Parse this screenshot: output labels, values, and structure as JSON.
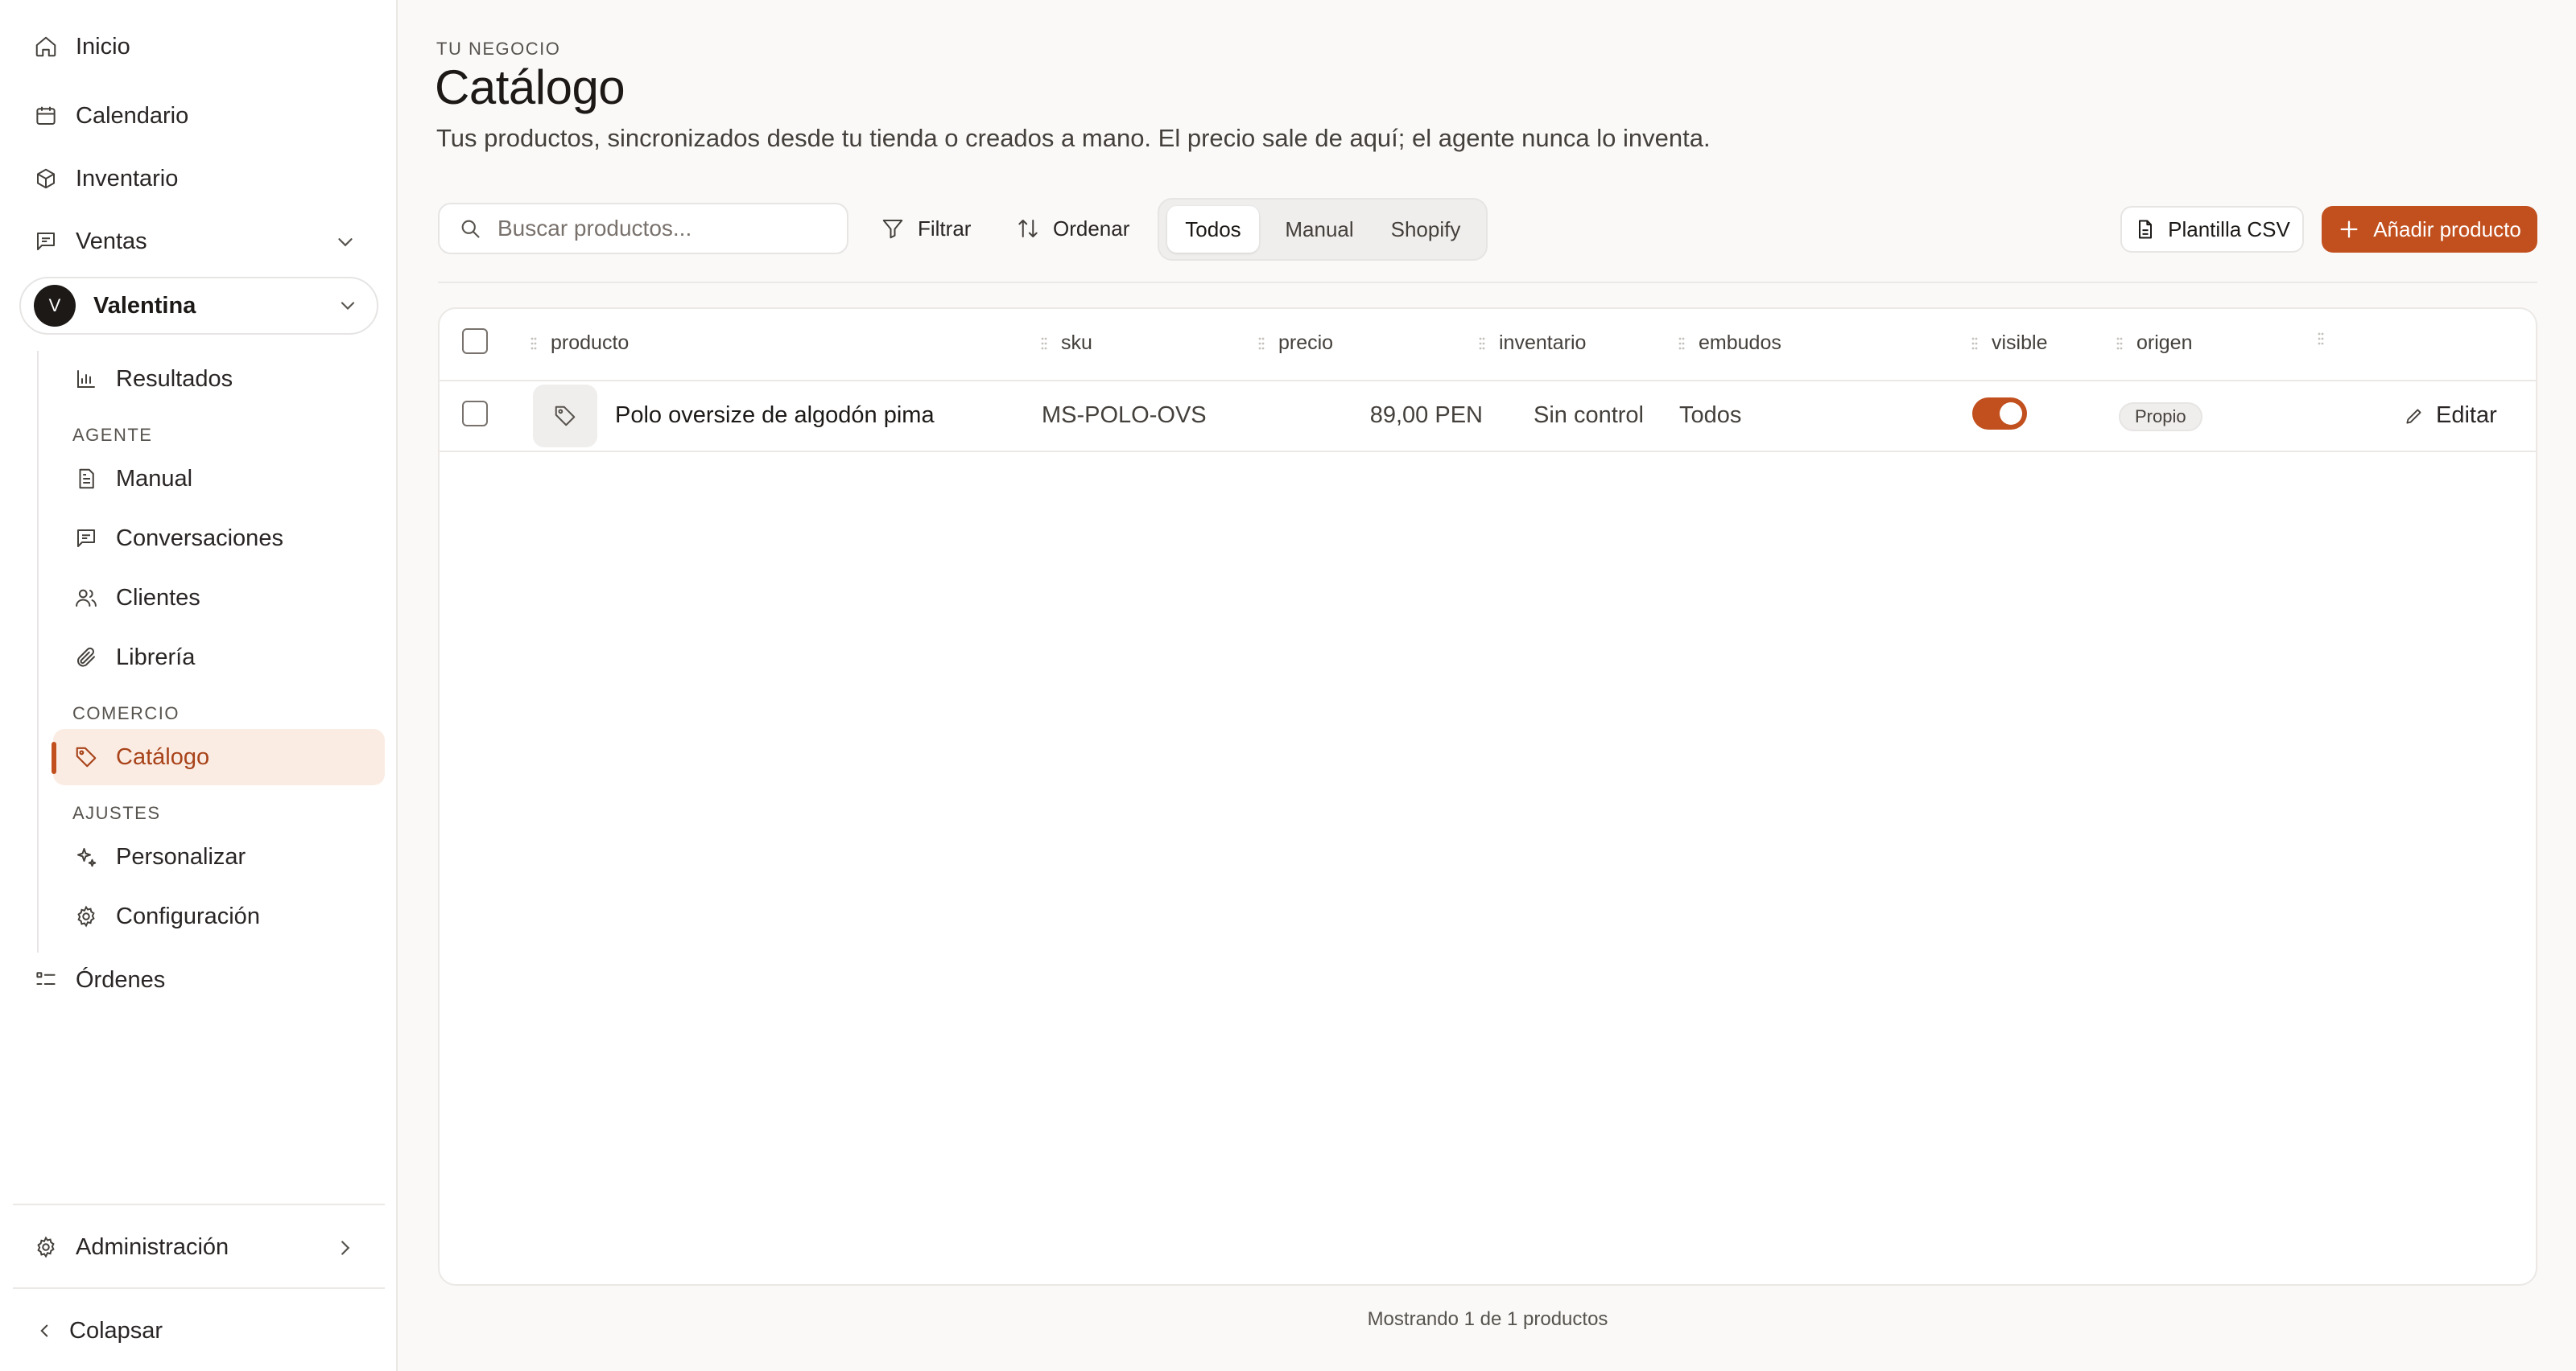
{
  "sidebar": {
    "items": {
      "inicio": "Inicio",
      "calendario": "Calendario",
      "inventario": "Inventario",
      "ventas": "Ventas",
      "ordenes": "Órdenes"
    },
    "account": {
      "initial": "V",
      "name": "Valentina"
    },
    "sub": {
      "resultados": "Resultados",
      "agente_label": "AGENTE",
      "manual": "Manual",
      "conversaciones": "Conversaciones",
      "clientes": "Clientes",
      "libreria": "Librería",
      "comercio_label": "COMERCIO",
      "catalogo": "Catálogo",
      "ajustes_label": "AJUSTES",
      "personalizar": "Personalizar",
      "configuracion": "Configuración"
    },
    "admin": "Administración",
    "collapse": "Colapsar"
  },
  "header": {
    "eyebrow": "TU NEGOCIO",
    "title": "Catálogo",
    "subtitle": "Tus productos, sincronizados desde tu tienda o creados a mano. El precio sale de aquí; el agente nunca lo inventa."
  },
  "toolbar": {
    "search_placeholder": "Buscar productos...",
    "filter": "Filtrar",
    "sort": "Ordenar",
    "segments": [
      "Todos",
      "Manual",
      "Shopify"
    ],
    "active_segment": "Todos",
    "csv_button": "Plantilla CSV",
    "add_button": "Añadir producto"
  },
  "table": {
    "columns": [
      "producto",
      "sku",
      "precio",
      "inventario",
      "embudos",
      "visible",
      "origen"
    ],
    "rows": [
      {
        "producto": "Polo oversize de algodón pima",
        "sku": "MS-POLO-OVS",
        "precio": "89,00 PEN",
        "inventario": "Sin control",
        "embudos": "Todos",
        "visible": true,
        "origen": "Propio",
        "action": "Editar"
      }
    ]
  },
  "footer": {
    "count_text": "Mostrando 1 de 1 productos"
  },
  "colors": {
    "accent": "#c2501f",
    "active_bg": "#fbece3",
    "active_text": "#a8431a"
  }
}
